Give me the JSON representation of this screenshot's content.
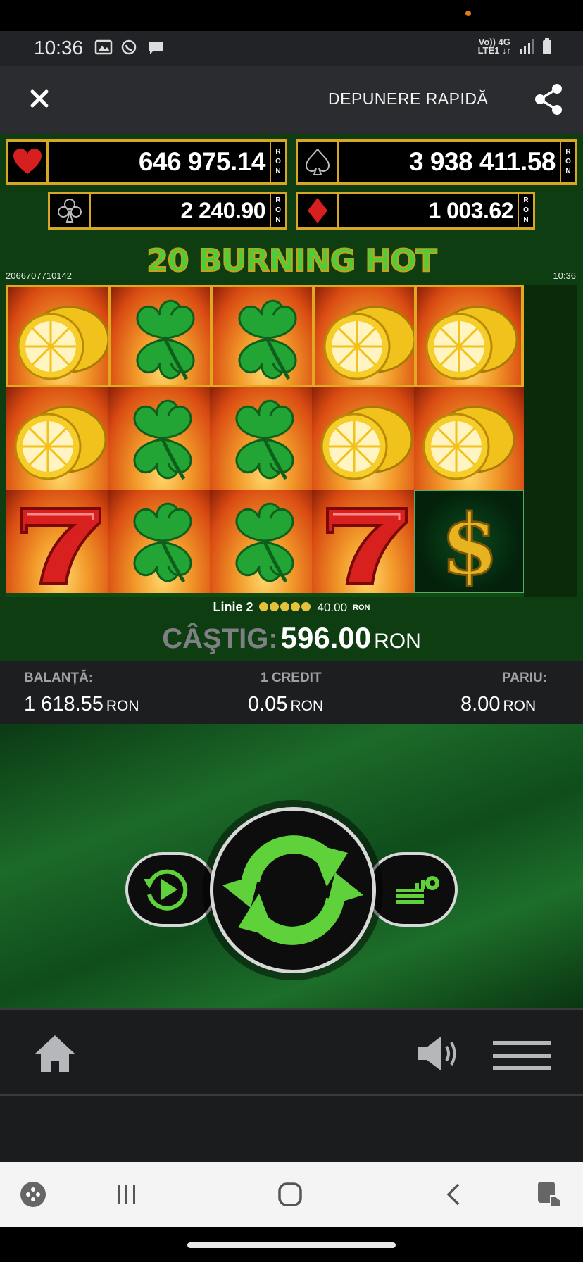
{
  "status_bar": {
    "time": "10:36",
    "icons_left": [
      "gallery-icon",
      "whatsapp-icon",
      "message-icon"
    ],
    "network_line1": "Vo)) 4G",
    "network_line2": "LTE1 ↓↑"
  },
  "header": {
    "close_icon": "close-icon",
    "deposit_label": "DEPUNERE RAPIDĂ",
    "share_icon": "share-icon"
  },
  "jackpots": {
    "hearts": {
      "value": "646 975.14",
      "currency": "RON"
    },
    "spades": {
      "value": "3 938 411.58",
      "currency": "RON"
    },
    "clubs": {
      "value": "2 240.90",
      "currency": "RON"
    },
    "diamonds": {
      "value": "1 003.62",
      "currency": "RON"
    }
  },
  "game": {
    "title": "20 BURNING HOT",
    "round_id": "2066707710142",
    "clock": "10:36",
    "reels": [
      [
        "lemon",
        "lemon",
        "seven"
      ],
      [
        "clover",
        "clover",
        "clover"
      ],
      [
        "clover",
        "clover",
        "clover"
      ],
      [
        "lemon",
        "lemon",
        "seven"
      ],
      [
        "lemon",
        "lemon",
        "dollar"
      ]
    ]
  },
  "win_line": {
    "label": "Linie 2",
    "coins": 5,
    "amount": "40.00",
    "currency": "RON"
  },
  "win": {
    "label": "CÂŞTIG:",
    "amount": "596.00",
    "currency": "RON"
  },
  "info": {
    "balance_label": "BALANȚĂ:",
    "balance_value": "1 618.55",
    "credit_label": "1 CREDIT",
    "credit_value": "0.05",
    "bet_label": "PARIU:",
    "bet_value": "8.00",
    "currency": "RON"
  },
  "controls": {
    "autoplay_icon": "autoplay-icon",
    "spin_icon": "spin-icon",
    "settings_icon": "bet-settings-icon"
  },
  "game_menu": {
    "home_icon": "home-icon",
    "sound_icon": "sound-icon",
    "menu_icon": "hamburger-menu-icon"
  },
  "android_nav": [
    "game-launcher-icon",
    "recent-apps-icon",
    "home-circle-icon",
    "back-icon",
    "screen-assist-icon"
  ],
  "colors": {
    "gold": "#d7a624",
    "game_green": "#0d3d10",
    "spin_green": "#5fd13a"
  }
}
